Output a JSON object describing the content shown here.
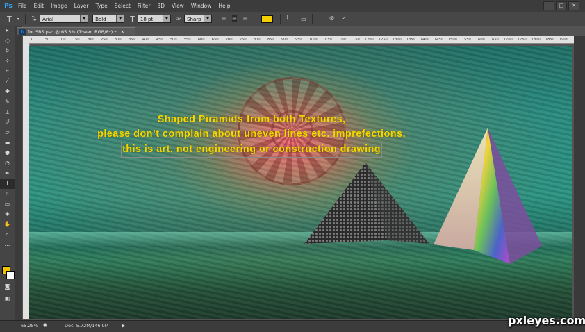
{
  "app": {
    "logo": "Ps"
  },
  "menu": [
    "File",
    "Edit",
    "Image",
    "Layer",
    "Type",
    "Select",
    "Filter",
    "3D",
    "View",
    "Window",
    "Help"
  ],
  "window_controls": [
    "_",
    "□",
    "✕"
  ],
  "options": {
    "tool_icon": "type-tool-icon",
    "font_family": "Arial",
    "font_style": "Bold",
    "size_icon": "font-size-icon",
    "font_size": "18 pt",
    "aa_label": "aᴀ",
    "antialias": "Sharp",
    "text_color": "#f5cf00"
  },
  "document": {
    "tab_label": "for SBS.psd @ 65.3% (Tower, RGB/8*) *",
    "tab_icon": "Ps",
    "ruler_ticks": [
      "0",
      "50",
      "100",
      "150",
      "200",
      "250",
      "300",
      "350",
      "400",
      "450",
      "500",
      "550",
      "600",
      "650",
      "700",
      "750",
      "800",
      "850",
      "900",
      "950",
      "1000",
      "1050",
      "1100",
      "1150",
      "1200",
      "1250",
      "1300",
      "1350",
      "1400",
      "1450",
      "1500",
      "1550",
      "1600",
      "1650",
      "1700",
      "1750",
      "1800",
      "1850",
      "1900",
      "1950"
    ]
  },
  "canvas_text": {
    "line1": "Shaped Piramids from both Textures,",
    "line2": "please don’t complain about uneven lines etc. imprefections,",
    "line3": "this is art, not engineering or construction drawing"
  },
  "status": {
    "zoom": "65.25%",
    "doc": "Doc: 5.72M/146.9M"
  },
  "watermark": "pxleyes.com",
  "colors": {
    "foreground": "#f5c400",
    "background": "#ffffff",
    "text": "#f2d800"
  }
}
